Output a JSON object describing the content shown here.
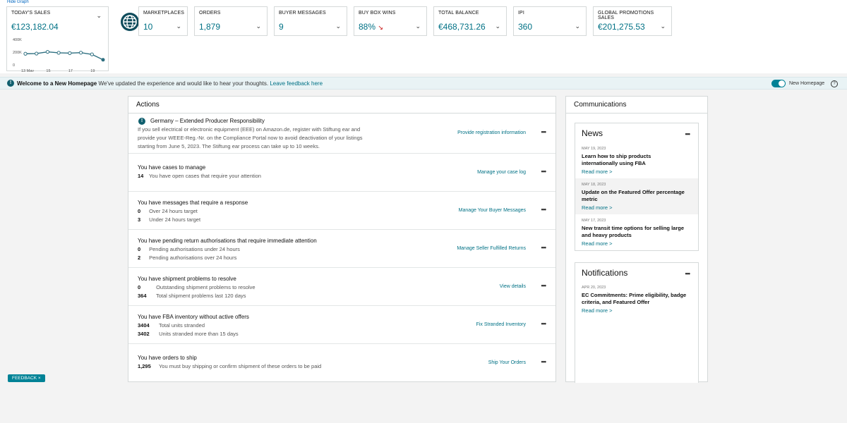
{
  "hide_graph_label": "Hide Graph",
  "sales": {
    "label": "TODAY'S SALES",
    "value": "€123,182.04",
    "chart_data": {
      "type": "line",
      "x_ticks": [
        "13 May",
        "15",
        "17",
        "19"
      ],
      "y_ticks": [
        "400K",
        "200K",
        "0"
      ],
      "values": [
        175000,
        178000,
        205000,
        190000,
        185000,
        192000,
        165000,
        80000
      ],
      "ylim": [
        0,
        400000
      ]
    }
  },
  "metrics": [
    {
      "label": "MARKETPLACES",
      "value": "10"
    },
    {
      "label": "ORDERS",
      "value": "1,879"
    },
    {
      "label": "BUYER MESSAGES",
      "value": "9"
    },
    {
      "label": "BUY BOX WINS",
      "value": "88%"
    },
    {
      "label": "TOTAL BALANCE",
      "value": "€468,731.26"
    },
    {
      "label": "IPI",
      "value": "360"
    },
    {
      "label": "GLOBAL PROMOTIONS SALES",
      "value": "€201,275.53"
    }
  ],
  "welcome": {
    "title": "Welcome to a New Homepage",
    "text": " We've updated the experience and would like to hear your thoughts. ",
    "link": "Leave feedback here",
    "toggle_label": "New Homepage"
  },
  "actions": {
    "title": "Actions",
    "alert": {
      "title": "Germany – Extended Producer Responsibility",
      "lines": [
        "If you sell electrical or electronic equipment (EEE) on Amazon.de, register with Stiftung ear and",
        "provide your WEEE-Reg.-Nr. on the Compliance Portal now to avoid deactivation of your listings",
        "starting from June 5, 2023. The Stiftung ear process can take up to 10 weeks."
      ],
      "link": "Provide registration information"
    },
    "rows": [
      {
        "title": "You have cases to manage",
        "items": [
          {
            "num": "14",
            "text": "You have open cases that require your attention"
          }
        ],
        "link": "Manage your case log"
      },
      {
        "title": "You have messages that require a response",
        "items": [
          {
            "num": "0",
            "text": "Over 24 hours target"
          },
          {
            "num": "3",
            "text": "Under 24 hours target"
          }
        ],
        "link": "Manage Your Buyer Messages"
      },
      {
        "title": "You have pending return authorisations that require immediate attention",
        "items": [
          {
            "num": "0",
            "text": "Pending authorisations under 24 hours"
          },
          {
            "num": "2",
            "text": "Pending authorisations over 24 hours"
          }
        ],
        "link": "Manage Seller Fulfilled Returns"
      },
      {
        "title": "You have shipment problems to resolve",
        "items": [
          {
            "num": "0",
            "text": "Outstanding shipment problems to resolve"
          },
          {
            "num": "364",
            "text": "Total shipment problems last 120 days"
          }
        ],
        "link": "View details"
      },
      {
        "title": "You have FBA inventory without active offers",
        "items": [
          {
            "num": "3404",
            "text": "Total units stranded"
          },
          {
            "num": "3402",
            "text": "Units stranded more than 15 days"
          }
        ],
        "link": "Fix Stranded Inventory"
      },
      {
        "title": "You have orders to ship",
        "items": [
          {
            "num": "1,295",
            "text": "You must buy shipping or confirm shipment of these orders to be paid"
          }
        ],
        "link": "Ship Your Orders"
      }
    ]
  },
  "communications": {
    "title": "Communications",
    "news": {
      "title": "News",
      "items": [
        {
          "date": "MAY 19, 2023",
          "title": "Learn how to ship products internationally using FBA",
          "more": "Read more >"
        },
        {
          "date": "MAY 18, 2023",
          "title": "Update on the Featured Offer percentage metric",
          "more": "Read more >"
        },
        {
          "date": "MAY 17, 2023",
          "title": "New transit time options for selling large and heavy products",
          "more": "Read more >"
        }
      ]
    },
    "notifications": {
      "title": "Notifications",
      "items": [
        {
          "date": "APR 20, 2023",
          "title": "EC Commitments: Prime eligibility, badge criteria, and Featured Offer",
          "more": "Read more >"
        }
      ]
    }
  },
  "feedback_label": "FEEDBACK ×",
  "colors": {
    "accent": "#007185",
    "teal": "#008296",
    "banner": "#e9f3f5"
  }
}
